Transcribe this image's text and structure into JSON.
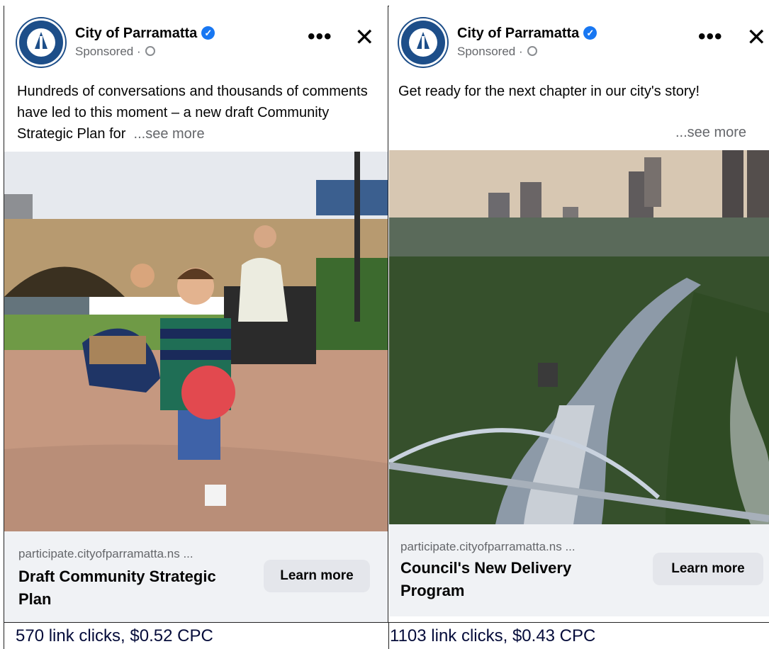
{
  "ads": [
    {
      "page_name": "City of Parramatta",
      "sponsored": "Sponsored ·",
      "more_icon": "•••",
      "close_icon": "✕",
      "body_text": "Hundreds of conversations and thousands of comments have led to this moment – a new draft Community Strategic Plan for",
      "see_more": "...see more",
      "domain": "participate.cityofparramatta.ns ...",
      "headline": "Draft Community Strategic Plan",
      "cta": "Learn more",
      "stats": "570 link clicks, $0.52 CPC"
    },
    {
      "page_name": "City of Parramatta",
      "sponsored": "Sponsored ·",
      "more_icon": "•••",
      "close_icon": "✕",
      "body_text": "Get ready for the next chapter in our city's story!",
      "see_more": "...see more",
      "domain": "participate.cityofparramatta.ns ...",
      "headline": "Council's New Delivery Program",
      "cta": "Learn more",
      "stats": "1103 link clicks, $0.43 CPC"
    }
  ],
  "colors": {
    "verified": "#1877f2",
    "stats_text": "#050c3a",
    "footer_bg": "#f0f2f5"
  }
}
